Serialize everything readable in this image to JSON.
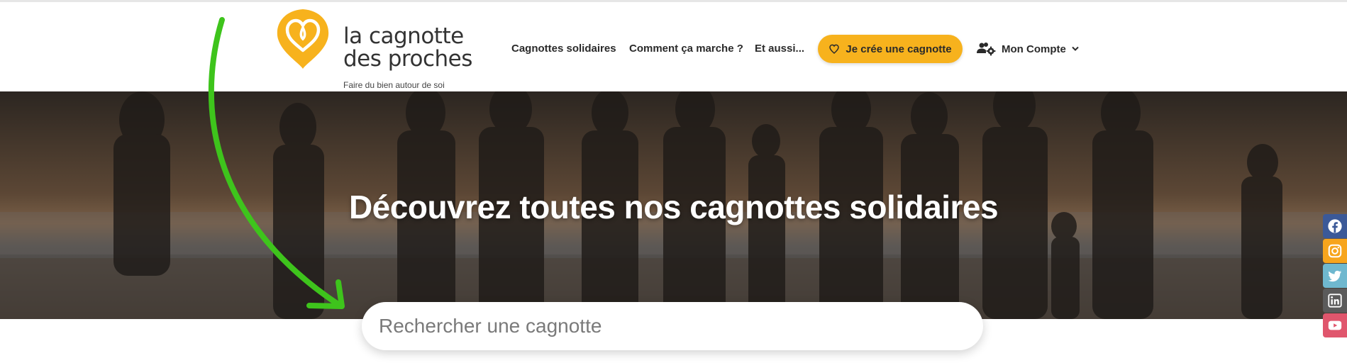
{
  "header": {
    "logo": {
      "line1": "la cagnotte",
      "line2": "des proches",
      "tagline": "Faire du bien autour de soi",
      "color": "#f7b21d"
    },
    "nav": [
      {
        "label": "Cagnottes solidaires"
      },
      {
        "label": "Comment ça marche ?"
      },
      {
        "label": "Et aussi..."
      }
    ],
    "cta": {
      "label": "Je crée une cagnotte",
      "icon": "heart-icon",
      "color": "#f7b21d"
    },
    "account": {
      "label": "Mon Compte",
      "icon": "users-gear-icon",
      "chevron": "chevron-down-icon"
    }
  },
  "hero": {
    "title": "Découvrez toutes nos cagnottes solidaires"
  },
  "search": {
    "placeholder": "Rechercher une cagnotte",
    "value": ""
  },
  "annotation": {
    "arrow_color": "#3ec41c"
  },
  "social": [
    {
      "name": "facebook",
      "icon": "facebook-icon",
      "color": "#3b5998"
    },
    {
      "name": "instagram",
      "icon": "instagram-icon",
      "color": "#f7a51d"
    },
    {
      "name": "twitter",
      "icon": "twitter-icon",
      "color": "#6fb8cf"
    },
    {
      "name": "linkedin",
      "icon": "linkedin-icon",
      "color": "#5b5b5b"
    },
    {
      "name": "youtube",
      "icon": "youtube-icon",
      "color": "#e0566d"
    }
  ]
}
